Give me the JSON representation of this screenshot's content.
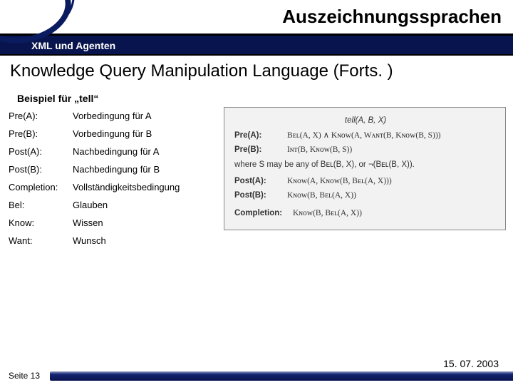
{
  "header": {
    "title": "Auszeichnungssprachen",
    "subtitle": "XML und Agenten"
  },
  "slide": {
    "title": "Knowledge Query Manipulation Language (Forts. )",
    "example_label": "Beispiel für „tell“"
  },
  "definitions": [
    {
      "term": "Pre(A):",
      "desc": "Vorbedingung für A"
    },
    {
      "term": "Pre(B):",
      "desc": "Vorbedingung für B"
    },
    {
      "term": "Post(A):",
      "desc": "Nachbedingung für A"
    },
    {
      "term": "Post(B):",
      "desc": "Nachbedingung für B"
    },
    {
      "term": "Completion:",
      "desc": "Vollständigkeitsbedingung"
    },
    {
      "term": "Bel:",
      "desc": "Glauben"
    },
    {
      "term": "Know:",
      "desc": "Wissen"
    },
    {
      "term": "Want:",
      "desc": "Wunsch"
    }
  ],
  "formula": {
    "head": "tell(A, B, X)",
    "preA_k": "Pre(A):",
    "preA_v1": "Bᴇʟ(A, X) ∧ Kɴᴏᴡ(A, Wᴀɴᴛ(B, Kɴᴏᴡ(B, S)))",
    "preA_v2": "Iɴᴛ(B, Kɴᴏᴡ(B, S))",
    "preA_note": "where S may be any of Bᴇʟ(B, X), or ¬(Bᴇʟ(B, X)).",
    "preB_k": "Pre(B):",
    "postA_k": "Post(A):",
    "postA_v": "Kɴᴏᴡ(A, Kɴᴏᴡ(B, Bᴇʟ(A, X)))",
    "postB_k": "Post(B):",
    "postB_v": "Kɴᴏᴡ(B, Bᴇʟ(A, X))",
    "comp_k": "Completion:",
    "comp_v": "Kɴᴏᴡ(B, Bᴇʟ(A, X))"
  },
  "footer": {
    "page": "Seite 13",
    "date": "15. 07. 2003"
  }
}
